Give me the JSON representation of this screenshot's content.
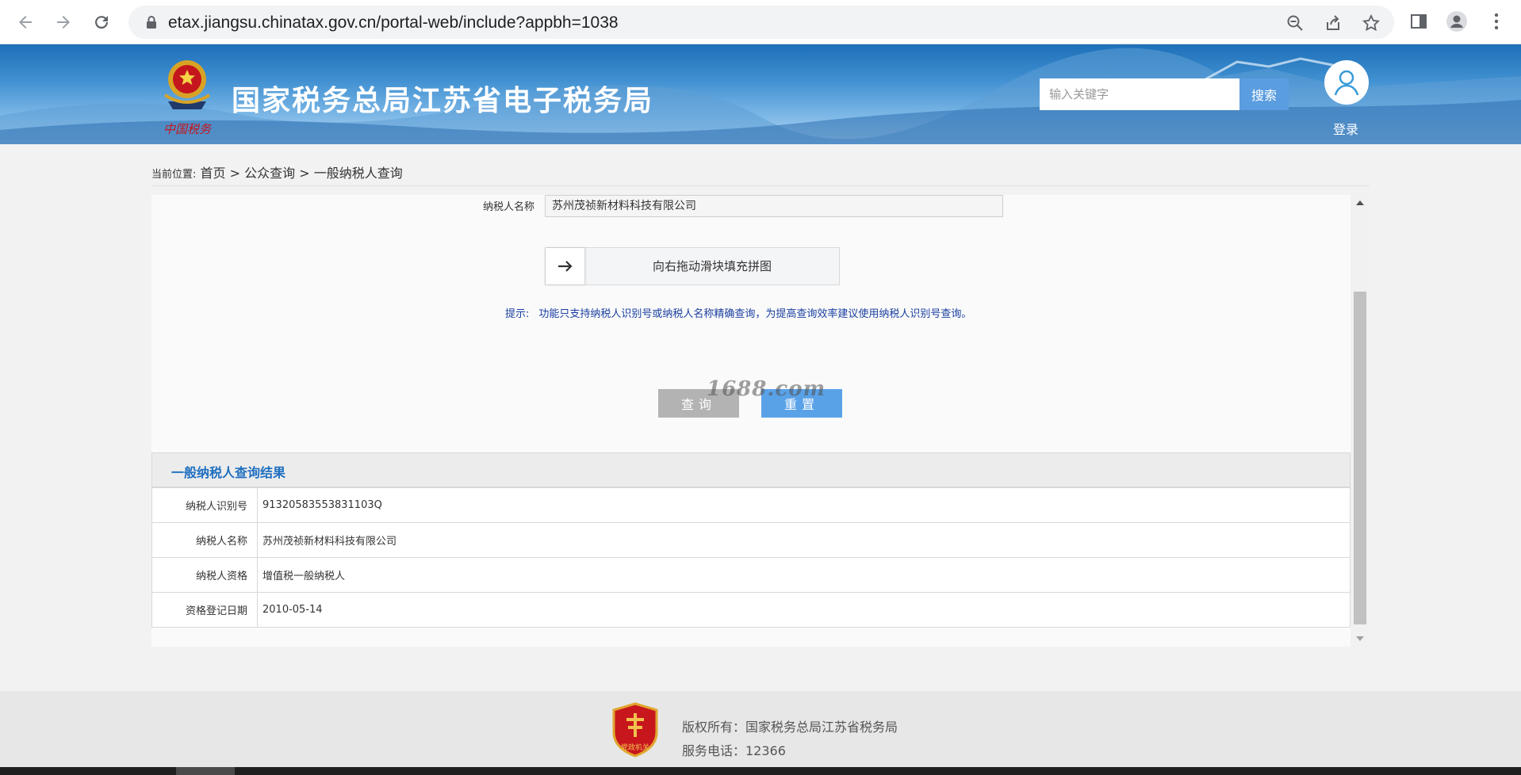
{
  "browser": {
    "url": "etax.jiangsu.chinatax.gov.cn/portal-web/include?appbh=1038"
  },
  "header": {
    "site_title": "国家税务总局江苏省电子税务局",
    "emblem_caption": "中国税务",
    "search_placeholder": "输入关键字",
    "search_button": "搜索",
    "login_label": "登录"
  },
  "breadcrumb": {
    "prefix": "当前位置:",
    "items": [
      "首页",
      "公众查询",
      "一般纳税人查询"
    ],
    "separator": ">"
  },
  "form": {
    "name_label": "纳税人名称",
    "name_value": "苏州茂祯新材料科技有限公司",
    "slider_text": "向右拖动滑块填充拼图",
    "hint_label": "提示:",
    "hint_text": "功能只支持纳税人识别号或纳税人名称精确查询，为提高查询效率建议使用纳税人识别号查询。",
    "watermark": "1688.com",
    "query_button": "查询",
    "reset_button": "重置"
  },
  "result": {
    "title": "一般纳税人查询结果",
    "rows": [
      {
        "label": "纳税人识别号",
        "value": "91320583553831103Q"
      },
      {
        "label": "纳税人名称",
        "value": "苏州茂祯新材料科技有限公司"
      },
      {
        "label": "纳税人资格",
        "value": "增值税一般纳税人"
      },
      {
        "label": "资格登记日期",
        "value": "2010-05-14"
      }
    ]
  },
  "footer": {
    "copyright": "版权所有：国家税务总局江苏省税务局",
    "phone": "服务电话：12366",
    "badge_caption": "党政机关"
  },
  "colors": {
    "banner_blue": "#2f80c8",
    "search_button": "#5a9de0",
    "reset_button": "#5aa2e8",
    "query_button": "#b3b3b3",
    "result_title": "#1f6fc0",
    "hint_text": "#1a3fa0"
  }
}
